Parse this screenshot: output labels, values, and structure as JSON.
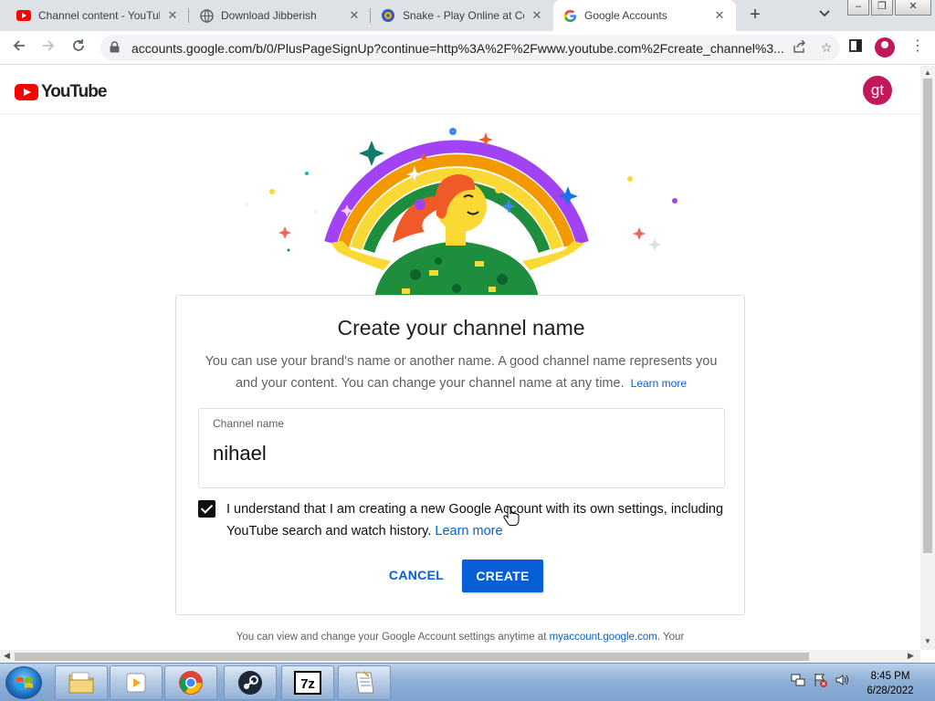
{
  "browser": {
    "tabs": [
      {
        "title": "Channel content - YouTube",
        "icon": "youtube-icon"
      },
      {
        "title": "Download Jibberish",
        "icon": "globe-icon"
      },
      {
        "title": "Snake - Play Online at Coolmath Games",
        "icon": "snake-icon"
      },
      {
        "title": "Google Accounts",
        "icon": "google-icon"
      }
    ],
    "active_tab": 3,
    "url": "accounts.google.com/b/0/PlusPageSignUp?continue=http%3A%2F%2Fwww.youtube.com%2Fcreate_channel%3..."
  },
  "header": {
    "logo_text": "YouTube",
    "avatar_initials": "gt"
  },
  "card": {
    "title": "Create your channel name",
    "description": "You can use your brand's name or another name. A good channel name represents you and your content. You can change your channel name at any time.",
    "learn_more": "Learn more",
    "field_label": "Channel name",
    "field_value": "nihael",
    "checkbox_checked": true,
    "checkbox_text": "I understand that I am creating a new Google Account with its own settings, including YouTube search and watch history.",
    "checkbox_learn_more": "Learn more",
    "cancel_label": "CANCEL",
    "create_label": "CREATE"
  },
  "footer": {
    "text": "You can view and change your Google Account settings anytime at",
    "link": "myaccount.google.com",
    "text_after": ". Your"
  },
  "taskbar": {
    "time": "8:45 PM",
    "date": "6/28/2022"
  },
  "colors": {
    "youtube_red": "#ff0000",
    "link_blue": "#065fd4",
    "avatar_bg": "#c2185b"
  }
}
